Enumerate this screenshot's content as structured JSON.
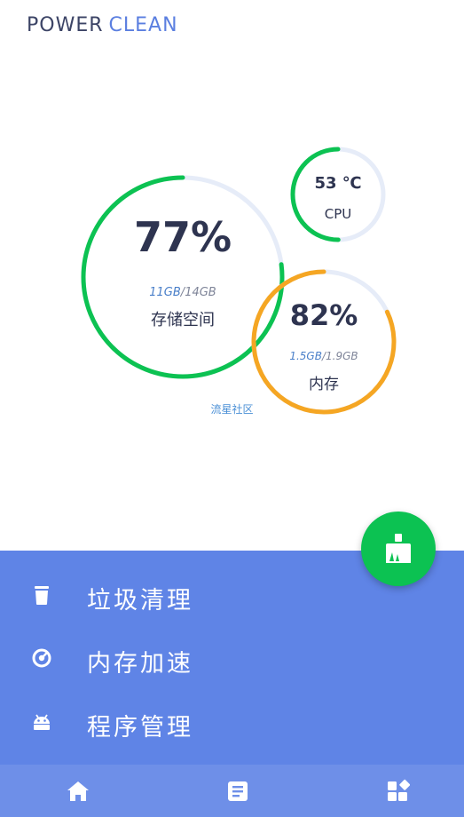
{
  "header": {
    "title_part1": "POWER",
    "title_part2": "CLEAN"
  },
  "gauges": {
    "storage": {
      "percent_text": "77%",
      "percent": 77,
      "used": "11GB",
      "separator": "/",
      "total": "14GB",
      "label": "存储空间",
      "color": "#0cc252"
    },
    "cpu": {
      "temperature": "53 ℃",
      "level": 0.5,
      "label": "CPU",
      "color": "#0cc252"
    },
    "memory": {
      "percent_text": "82%",
      "percent": 82,
      "used": "1.5GB",
      "separator": "/",
      "total": "1.9GB",
      "label": "内存",
      "color": "#f5a623"
    },
    "track_color": "#e6ecf8"
  },
  "community_link": "流星社区",
  "menu": {
    "items": [
      {
        "label": "垃圾清理",
        "icon": "trash-icon"
      },
      {
        "label": "内存加速",
        "icon": "gauge-icon"
      },
      {
        "label": "程序管理",
        "icon": "android-icon"
      }
    ]
  },
  "fab": {
    "icon": "broom-icon",
    "color": "#0cc252"
  },
  "bottom_nav": {
    "items": [
      {
        "icon": "home-icon"
      },
      {
        "icon": "article-icon"
      },
      {
        "icon": "apps-icon"
      }
    ],
    "background": "#6e8fe8"
  },
  "panel_color": "#5f84e6"
}
